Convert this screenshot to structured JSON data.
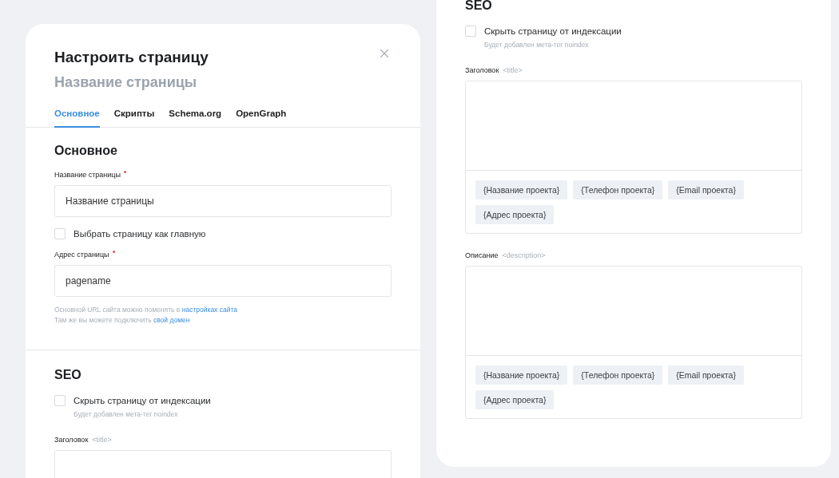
{
  "settings_dialog": {
    "title": "Настроить страницу",
    "subtitle": "Название страницы",
    "tabs": [
      {
        "label": "Основное",
        "selected": true
      },
      {
        "label": "Скрипты",
        "selected": false
      },
      {
        "label": "Schema.org",
        "selected": false
      },
      {
        "label": "OpenGraph",
        "selected": false
      }
    ],
    "sections": [
      {
        "heading": "Основное",
        "items": [
          {
            "kind": "input",
            "label": "Название страницы",
            "required": true,
            "value": "Название страницы"
          },
          {
            "kind": "checkbox",
            "label": "Выбрать страницу как главную",
            "checked": false
          },
          {
            "kind": "input",
            "label": "Адрес страницы",
            "required": true,
            "value": "pagename"
          },
          {
            "kind": "note",
            "lines": [
              {
                "text": "Основной URL сайта можно поменять в",
                "link": "настройках сайта"
              },
              {
                "text": "Там же вы можете подключить",
                "link": "свой домен"
              }
            ]
          }
        ]
      },
      {
        "heading": "SEO",
        "items": [
          {
            "kind": "checkbox",
            "label": "Скрыть страницу от индексации",
            "hint": "Будет добавлен мета-тег noindex",
            "checked": false
          },
          {
            "kind": "textarea",
            "label": "Заголовок",
            "tag": "<title>"
          }
        ]
      }
    ]
  },
  "seo_panel": {
    "heading": "SEO",
    "items": [
      {
        "kind": "checkbox",
        "label": "Скрыть страницу от индексации",
        "hint": "Будет добавлен мета-тег noindex",
        "checked": false
      },
      {
        "kind": "textarea",
        "label": "Заголовок",
        "tag": "<title>",
        "chips": [
          "{Название проекта}",
          "{Телефон проекта}",
          "{Email проекта}",
          "{Адрес проекта}"
        ]
      },
      {
        "kind": "textarea",
        "label": "Описание",
        "tag": "<description>",
        "chips": [
          "{Название проекта}",
          "{Телефон проекта}",
          "{Email проекта}",
          "{Адрес проекта}"
        ]
      }
    ]
  }
}
